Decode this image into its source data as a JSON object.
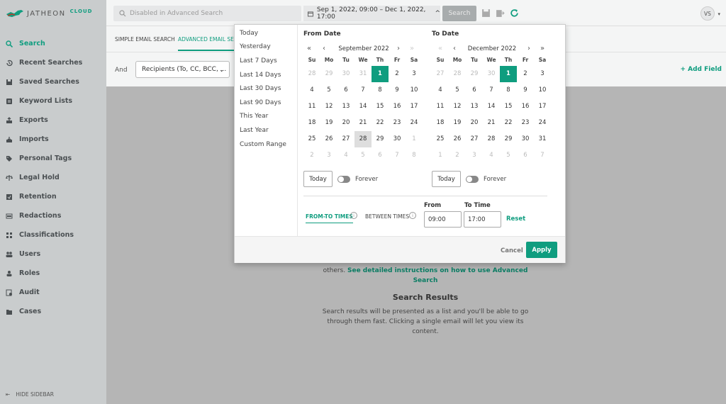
{
  "brand": {
    "name": "JATHEON",
    "suffix": "CLOUD"
  },
  "colors": {
    "accent": "#0f9d7f",
    "sidebar_bg": "#c9cccd",
    "overlay": "#b5b5b5"
  },
  "sidebar": {
    "items": [
      {
        "label": "Search",
        "icon": "search-icon"
      },
      {
        "label": "Recent Searches",
        "icon": "history-icon"
      },
      {
        "label": "Saved Searches",
        "icon": "save-icon"
      },
      {
        "label": "Keyword Lists",
        "icon": "list-icon"
      },
      {
        "label": "Exports",
        "icon": "export-icon"
      },
      {
        "label": "Imports",
        "icon": "import-icon"
      },
      {
        "label": "Personal Tags",
        "icon": "tag-icon"
      },
      {
        "label": "Legal Hold",
        "icon": "scale-icon"
      },
      {
        "label": "Retention",
        "icon": "retention-icon"
      },
      {
        "label": "Redactions",
        "icon": "redaction-icon"
      },
      {
        "label": "Classifications",
        "icon": "classification-icon"
      },
      {
        "label": "Users",
        "icon": "users-icon"
      },
      {
        "label": "Roles",
        "icon": "roles-icon"
      },
      {
        "label": "Audit",
        "icon": "audit-icon"
      },
      {
        "label": "Cases",
        "icon": "folder-icon"
      }
    ],
    "hide_label": "HIDE SIDEBAR"
  },
  "topbar": {
    "search_placeholder": "Disabled in Advanced Search",
    "date_range": "Sep 1, 2022, 09:00 – Dec 1, 2022, 17:00",
    "search_button": "Search",
    "avatar_initials": "VS"
  },
  "tabs": {
    "simple": "SIMPLE EMAIL SEARCH",
    "advanced": "ADVANCED EMAIL SEA"
  },
  "filter": {
    "and_label": "And",
    "field_value": "Recipients (To, CC, BCC, ...",
    "add_field": "+ Add Field"
  },
  "main": {
    "help_text_partial": "others.",
    "help_link": "See detailed instructions on how to use Advanced Search",
    "results_title": "Search Results",
    "results_text": "Search results will be presented as a list and you'll be able to go through them fast. Clicking a single email will let you view its content."
  },
  "picker": {
    "presets": [
      "Today",
      "Yesterday",
      "Last 7 Days",
      "Last 14 Days",
      "Last 30 Days",
      "Last 90 Days",
      "This Year",
      "Last Year",
      "Custom Range"
    ],
    "from_label": "From Date",
    "to_label": "To Date",
    "dow": [
      "Su",
      "Mo",
      "Tu",
      "We",
      "Th",
      "Fr",
      "Sa"
    ],
    "from_month": "September 2022",
    "to_month": "December 2022",
    "today_button": "Today",
    "forever_label": "Forever",
    "time_tabs": {
      "from_to": "FROM-TO TIMES",
      "between": "BETWEEN TIMES"
    },
    "time_from_label": "From",
    "time_to_label": "To Time",
    "time_from_value": "09:00",
    "time_to_value": "17:00",
    "reset": "Reset",
    "cancel": "Cancel",
    "apply": "Apply",
    "from_weeks": [
      [
        [
          "28",
          "m"
        ],
        [
          "29",
          "m"
        ],
        [
          "30",
          "m"
        ],
        [
          "31",
          "m"
        ],
        [
          "1",
          "s"
        ],
        [
          "2",
          ""
        ],
        [
          "3",
          ""
        ]
      ],
      [
        [
          "4",
          ""
        ],
        [
          "5",
          ""
        ],
        [
          "6",
          ""
        ],
        [
          "7",
          ""
        ],
        [
          "8",
          ""
        ],
        [
          "9",
          ""
        ],
        [
          "10",
          ""
        ]
      ],
      [
        [
          "11",
          ""
        ],
        [
          "12",
          ""
        ],
        [
          "13",
          ""
        ],
        [
          "14",
          ""
        ],
        [
          "15",
          ""
        ],
        [
          "16",
          ""
        ],
        [
          "17",
          ""
        ]
      ],
      [
        [
          "18",
          ""
        ],
        [
          "19",
          ""
        ],
        [
          "20",
          ""
        ],
        [
          "21",
          ""
        ],
        [
          "22",
          ""
        ],
        [
          "23",
          ""
        ],
        [
          "24",
          ""
        ]
      ],
      [
        [
          "25",
          ""
        ],
        [
          "26",
          ""
        ],
        [
          "27",
          ""
        ],
        [
          "28",
          "h"
        ],
        [
          "29",
          ""
        ],
        [
          "30",
          ""
        ],
        [
          "1",
          "m"
        ]
      ],
      [
        [
          "2",
          "m"
        ],
        [
          "3",
          "m"
        ],
        [
          "4",
          "m"
        ],
        [
          "5",
          "m"
        ],
        [
          "6",
          "m"
        ],
        [
          "7",
          "m"
        ],
        [
          "8",
          "m"
        ]
      ]
    ],
    "to_weeks": [
      [
        [
          "27",
          "m"
        ],
        [
          "28",
          "m"
        ],
        [
          "29",
          "m"
        ],
        [
          "30",
          "m"
        ],
        [
          "1",
          "s"
        ],
        [
          "2",
          ""
        ],
        [
          "3",
          ""
        ]
      ],
      [
        [
          "4",
          ""
        ],
        [
          "5",
          ""
        ],
        [
          "6",
          ""
        ],
        [
          "7",
          ""
        ],
        [
          "8",
          ""
        ],
        [
          "9",
          ""
        ],
        [
          "10",
          ""
        ]
      ],
      [
        [
          "11",
          ""
        ],
        [
          "12",
          ""
        ],
        [
          "13",
          ""
        ],
        [
          "14",
          ""
        ],
        [
          "15",
          ""
        ],
        [
          "16",
          ""
        ],
        [
          "17",
          ""
        ]
      ],
      [
        [
          "18",
          ""
        ],
        [
          "19",
          ""
        ],
        [
          "20",
          ""
        ],
        [
          "21",
          ""
        ],
        [
          "22",
          ""
        ],
        [
          "23",
          ""
        ],
        [
          "24",
          ""
        ]
      ],
      [
        [
          "25",
          ""
        ],
        [
          "26",
          ""
        ],
        [
          "27",
          ""
        ],
        [
          "28",
          ""
        ],
        [
          "29",
          ""
        ],
        [
          "30",
          ""
        ],
        [
          "31",
          ""
        ]
      ],
      [
        [
          "1",
          "m"
        ],
        [
          "2",
          "m"
        ],
        [
          "3",
          "m"
        ],
        [
          "4",
          "m"
        ],
        [
          "5",
          "m"
        ],
        [
          "6",
          "m"
        ],
        [
          "7",
          "m"
        ]
      ]
    ]
  }
}
